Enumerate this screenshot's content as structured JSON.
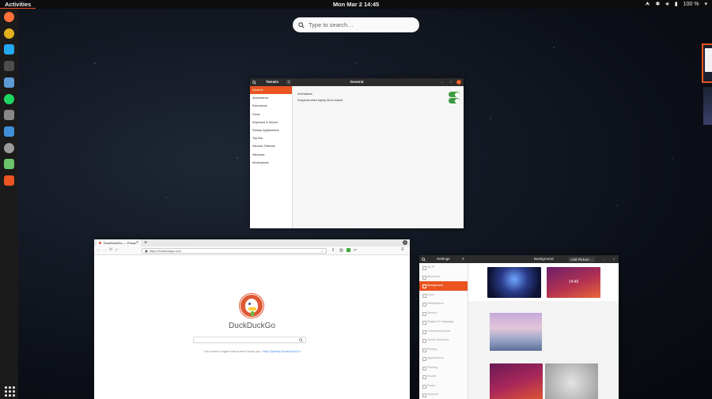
{
  "topbar": {
    "activities": "Activities",
    "clock": "Mon Mar 2  14:45",
    "battery": "100 %"
  },
  "dock": {
    "apps": [
      {
        "name": "firefox-icon",
        "color": "#ff7139"
      },
      {
        "name": "chrome-icon",
        "color": "#e3b11e"
      },
      {
        "name": "vscode-icon",
        "color": "#23a8f2"
      },
      {
        "name": "terminal-icon",
        "color": "#4d4d4d"
      },
      {
        "name": "text-editor-icon",
        "color": "#5e9ad6"
      },
      {
        "name": "spotify-icon",
        "color": "#1ed760"
      },
      {
        "name": "telescope-icon",
        "color": "#888888"
      },
      {
        "name": "libreoffice-writer-icon",
        "color": "#3f8fd8"
      },
      {
        "name": "disk-usage-icon",
        "color": "#9a9a9a"
      },
      {
        "name": "system-monitor-icon",
        "color": "#6cc36a"
      },
      {
        "name": "software-center-icon",
        "color": "#e95420"
      }
    ]
  },
  "search": {
    "placeholder": "Type to search…"
  },
  "tweaks": {
    "app_title": "Tweaks",
    "page_title": "General",
    "items": [
      "General",
      "Appearance",
      "Extensions",
      "Fonts",
      "Keyboard & Mouse",
      "Startup Applications",
      "Top Bar",
      "Window Titlebars",
      "Windows",
      "Workspaces"
    ],
    "selected": 0,
    "settings": [
      {
        "label": "Animations",
        "on": true
      },
      {
        "label": "Suspend when laptop lid is closed",
        "on": true
      }
    ]
  },
  "firefox": {
    "tab_title": "DuckDuckGo — Privac…",
    "url": "https://duckduckgo.com",
    "brand": "DuckDuckGo",
    "tagline": "The search engine that doesn't track you.",
    "help_link": "Help Spread DuckDuckGo!"
  },
  "settings": {
    "app_title": "Settings",
    "page_title": "Background",
    "add_button": "Add Picture…",
    "items": [
      "Wi-Fi",
      "Bluetooth",
      "Background",
      "Dock",
      "Notifications",
      "Search",
      "Region & Language",
      "Universal Access",
      "Online Accounts",
      "Privacy",
      "Applications",
      "Sharing",
      "Sound",
      "Power",
      "Network"
    ],
    "selected": 2
  }
}
